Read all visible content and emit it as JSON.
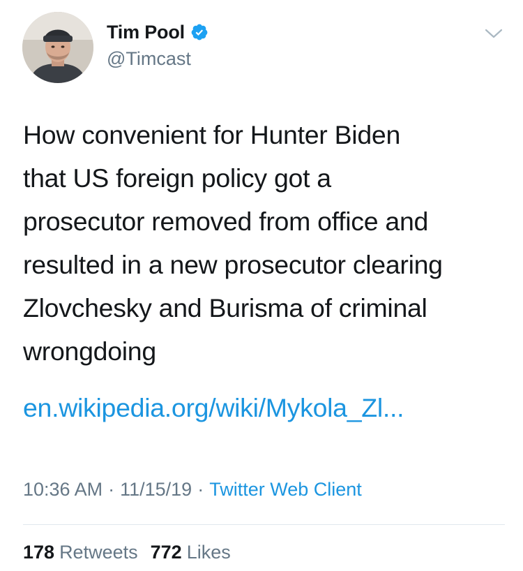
{
  "author": {
    "display_name": "Tim Pool",
    "handle": "@Timcast",
    "verified": true
  },
  "tweet": {
    "text": "How convenient for Hunter Biden\nthat US foreign policy got a\nprosecutor removed from office and\nresulted in a new prosecutor clearing\nZlovchesky and Burisma of criminal\nwrongdoing",
    "link_text": "en.wikipedia.org/wiki/Mykola_Zl..."
  },
  "meta": {
    "time": "10:36 AM",
    "separator": "·",
    "date": "11/15/19",
    "client": "Twitter Web Client"
  },
  "stats": {
    "retweets_count": "178",
    "retweets_label": "Retweets",
    "likes_count": "772",
    "likes_label": "Likes"
  },
  "colors": {
    "link": "#1b95e0",
    "secondary_text": "#657786",
    "primary_text": "#14171a",
    "verified_badge": "#1da1f2"
  },
  "icons": {
    "verified": "verified-badge-icon",
    "menu": "chevron-down-icon"
  }
}
